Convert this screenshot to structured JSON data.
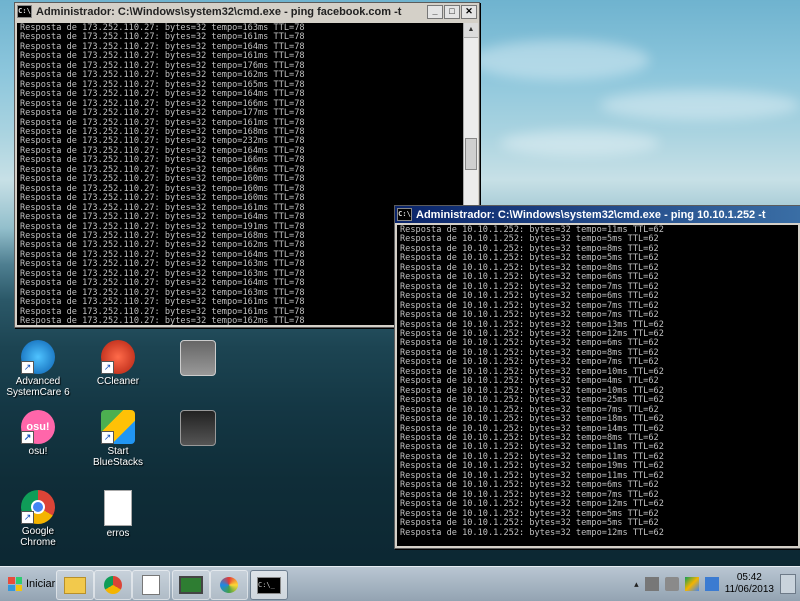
{
  "window_back": {
    "title": "Administrador: C:\\Windows\\system32\\cmd.exe - ping  facebook.com -t",
    "lines": [
      "Resposta de 173.252.110.27: bytes=32 tempo=163ms TTL=78",
      "Resposta de 173.252.110.27: bytes=32 tempo=161ms TTL=78",
      "Resposta de 173.252.110.27: bytes=32 tempo=164ms TTL=78",
      "Resposta de 173.252.110.27: bytes=32 tempo=161ms TTL=78",
      "Resposta de 173.252.110.27: bytes=32 tempo=176ms TTL=78",
      "Resposta de 173.252.110.27: bytes=32 tempo=162ms TTL=78",
      "Resposta de 173.252.110.27: bytes=32 tempo=165ms TTL=78",
      "Resposta de 173.252.110.27: bytes=32 tempo=164ms TTL=78",
      "Resposta de 173.252.110.27: bytes=32 tempo=166ms TTL=78",
      "Resposta de 173.252.110.27: bytes=32 tempo=177ms TTL=78",
      "Resposta de 173.252.110.27: bytes=32 tempo=161ms TTL=78",
      "Resposta de 173.252.110.27: bytes=32 tempo=168ms TTL=78",
      "Resposta de 173.252.110.27: bytes=32 tempo=232ms TTL=78",
      "Resposta de 173.252.110.27: bytes=32 tempo=164ms TTL=78",
      "Resposta de 173.252.110.27: bytes=32 tempo=166ms TTL=78",
      "Resposta de 173.252.110.27: bytes=32 tempo=166ms TTL=78",
      "Resposta de 173.252.110.27: bytes=32 tempo=160ms TTL=78",
      "Resposta de 173.252.110.27: bytes=32 tempo=160ms TTL=78",
      "Resposta de 173.252.110.27: bytes=32 tempo=160ms TTL=78",
      "Resposta de 173.252.110.27: bytes=32 tempo=161ms TTL=78",
      "Resposta de 173.252.110.27: bytes=32 tempo=164ms TTL=78",
      "Resposta de 173.252.110.27: bytes=32 tempo=191ms TTL=78",
      "Resposta de 173.252.110.27: bytes=32 tempo=168ms TTL=78",
      "Resposta de 173.252.110.27: bytes=32 tempo=162ms TTL=78",
      "Resposta de 173.252.110.27: bytes=32 tempo=164ms TTL=78",
      "Resposta de 173.252.110.27: bytes=32 tempo=163ms TTL=78",
      "Resposta de 173.252.110.27: bytes=32 tempo=163ms TTL=78",
      "Resposta de 173.252.110.27: bytes=32 tempo=164ms TTL=78",
      "Resposta de 173.252.110.27: bytes=32 tempo=163ms TTL=78",
      "Resposta de 173.252.110.27: bytes=32 tempo=161ms TTL=78",
      "Resposta de 173.252.110.27: bytes=32 tempo=161ms TTL=78",
      "Resposta de 173.252.110.27: bytes=32 tempo=162ms TTL=78"
    ]
  },
  "window_front": {
    "title": "Administrador: C:\\Windows\\system32\\cmd.exe - ping  10.10.1.252 -t",
    "lines": [
      "Resposta de 10.10.1.252: bytes=32 tempo=11ms TTL=62",
      "Resposta de 10.10.1.252: bytes=32 tempo=5ms TTL=62",
      "Resposta de 10.10.1.252: bytes=32 tempo=8ms TTL=62",
      "Resposta de 10.10.1.252: bytes=32 tempo=5ms TTL=62",
      "Resposta de 10.10.1.252: bytes=32 tempo=8ms TTL=62",
      "Resposta de 10.10.1.252: bytes=32 tempo=6ms TTL=62",
      "Resposta de 10.10.1.252: bytes=32 tempo=7ms TTL=62",
      "Resposta de 10.10.1.252: bytes=32 tempo=6ms TTL=62",
      "Resposta de 10.10.1.252: bytes=32 tempo=7ms TTL=62",
      "Resposta de 10.10.1.252: bytes=32 tempo=7ms TTL=62",
      "Resposta de 10.10.1.252: bytes=32 tempo=13ms TTL=62",
      "Resposta de 10.10.1.252: bytes=32 tempo=12ms TTL=62",
      "Resposta de 10.10.1.252: bytes=32 tempo=6ms TTL=62",
      "Resposta de 10.10.1.252: bytes=32 tempo=8ms TTL=62",
      "Resposta de 10.10.1.252: bytes=32 tempo=7ms TTL=62",
      "Resposta de 10.10.1.252: bytes=32 tempo=10ms TTL=62",
      "Resposta de 10.10.1.252: bytes=32 tempo=4ms TTL=62",
      "Resposta de 10.10.1.252: bytes=32 tempo=10ms TTL=62",
      "Resposta de 10.10.1.252: bytes=32 tempo=25ms TTL=62",
      "Resposta de 10.10.1.252: bytes=32 tempo=7ms TTL=62",
      "Resposta de 10.10.1.252: bytes=32 tempo=18ms TTL=62",
      "Resposta de 10.10.1.252: bytes=32 tempo=14ms TTL=62",
      "Resposta de 10.10.1.252: bytes=32 tempo=8ms TTL=62",
      "Resposta de 10.10.1.252: bytes=32 tempo=11ms TTL=62",
      "Resposta de 10.10.1.252: bytes=32 tempo=11ms TTL=62",
      "Resposta de 10.10.1.252: bytes=32 tempo=19ms TTL=62",
      "Resposta de 10.10.1.252: bytes=32 tempo=11ms TTL=62",
      "Resposta de 10.10.1.252: bytes=32 tempo=6ms TTL=62",
      "Resposta de 10.10.1.252: bytes=32 tempo=7ms TTL=62",
      "Resposta de 10.10.1.252: bytes=32 tempo=12ms TTL=62",
      "Resposta de 10.10.1.252: bytes=32 tempo=5ms TTL=62",
      "Resposta de 10.10.1.252: bytes=32 tempo=5ms TTL=62",
      "Resposta de 10.10.1.252: bytes=32 tempo=12ms TTL=62"
    ]
  },
  "desktop_icons": [
    {
      "label": "Advanced SystemCare 6",
      "icon": "advanced-systemcare-icon"
    },
    {
      "label": "CCleaner",
      "icon": "ccleaner-icon"
    },
    {
      "label": "osu!",
      "icon": "osu-icon"
    },
    {
      "label": "Start BlueStacks",
      "icon": "bluestacks-icon"
    },
    {
      "label": "Google Chrome",
      "icon": "chrome-icon"
    },
    {
      "label": "erros",
      "icon": "text-file-icon"
    }
  ],
  "taskbar": {
    "start_label": "Iniciar",
    "clock_time": "05:42",
    "clock_date": "11/06/2013"
  },
  "colors": {
    "console_bg": "#000000",
    "console_fg": "#c0c0c0",
    "titlebar_active": "#0a246a"
  }
}
